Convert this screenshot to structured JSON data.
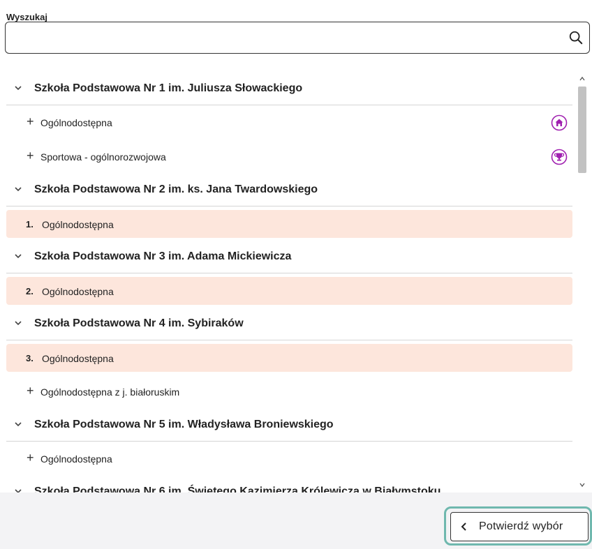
{
  "search": {
    "label": "Wyszukaj",
    "value": "",
    "placeholder": ""
  },
  "schools": [
    {
      "name": "Szkoła Podstawowa Nr 1 im. Juliusza Słowackiego",
      "classes": [
        {
          "label": "Ogólnodostępna",
          "icon": "home-icon"
        },
        {
          "label": "Sportowa - ogólnorozwojowa",
          "icon": "trophy-icon"
        }
      ]
    },
    {
      "name": "Szkoła Podstawowa Nr 2 im. ks. Jana Twardowskiego",
      "classes": [
        {
          "label": "Ogólnodostępna",
          "selected_number": "1."
        }
      ]
    },
    {
      "name": "Szkoła Podstawowa Nr 3 im. Adama Mickiewicza",
      "classes": [
        {
          "label": "Ogólnodostępna",
          "selected_number": "2."
        }
      ]
    },
    {
      "name": "Szkoła Podstawowa Nr 4 im. Sybiraków",
      "classes": [
        {
          "label": "Ogólnodostępna",
          "selected_number": "3."
        },
        {
          "label": "Ogólnodostępna z j. białoruskim"
        }
      ]
    },
    {
      "name": "Szkoła Podstawowa Nr 5 im. Władysława Broniewskiego",
      "classes": [
        {
          "label": "Ogólnodostępna"
        }
      ]
    },
    {
      "name": "Szkoła Podstawowa Nr 6 im. Świętego Kazimierza Królewicza w Białymstoku",
      "classes": []
    }
  ],
  "footer": {
    "confirm_label": "Potwierdź wybór"
  },
  "colors": {
    "accent": "#a020b0",
    "selected_bg": "#fde6dc",
    "focus_ring": "#6fb8ae"
  }
}
